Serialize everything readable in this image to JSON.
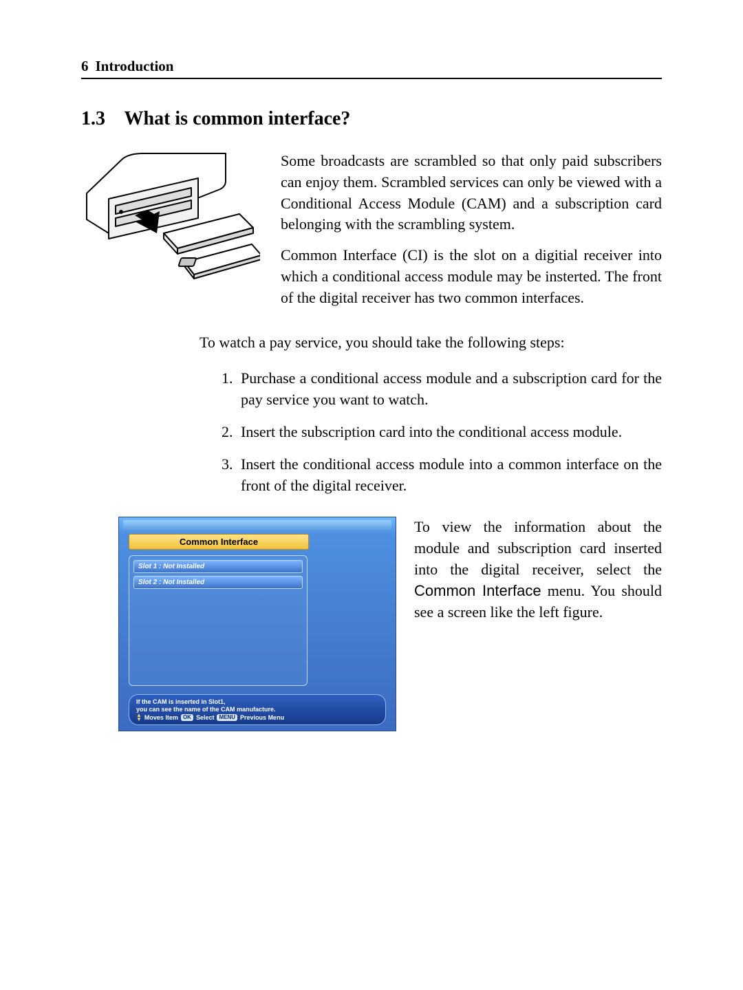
{
  "header": {
    "page_number": "6",
    "chapter": "Introduction"
  },
  "section": {
    "number": "1.3",
    "title": "What is common interface?"
  },
  "paragraphs": {
    "p1": "Some broadcasts are scrambled so that only paid subscribers can enjoy them. Scrambled services can only be viewed with a Conditional Access Module (CAM) and a subscription card belonging with the scrambling system.",
    "p2": "Common Interface (CI) is the slot on a digitial receiver into which a conditional access module may be insterted. The front of the digital receiver has two common interfaces.",
    "lead": "To watch a pay service, you should take the following steps:",
    "p3_a": "To view the information about the module and subscription card inserted into the digital receiver, select the ",
    "p3_ui": "Common Interface",
    "p3_b": " menu.   You should see a screen like the left figure."
  },
  "steps": [
    "Purchase a conditional access module and a subscription card for the pay service you want to watch.",
    "Insert the subscription card into the conditional access module.",
    "Insert the conditional access module into a common interface on the front of the digital receiver."
  ],
  "screenshot": {
    "title": "Common Interface",
    "slot1": "Slot 1 : Not Installed",
    "slot2": "Slot 2 : Not Installed",
    "help1": "If the CAM is inserted in Slot1,",
    "help2": "you can see the name of the CAM manufacture.",
    "nav_moves": "Moves Item",
    "nav_ok": "OK",
    "nav_select": "Select",
    "nav_menu": "MENU",
    "nav_prev": "Previous Menu"
  }
}
